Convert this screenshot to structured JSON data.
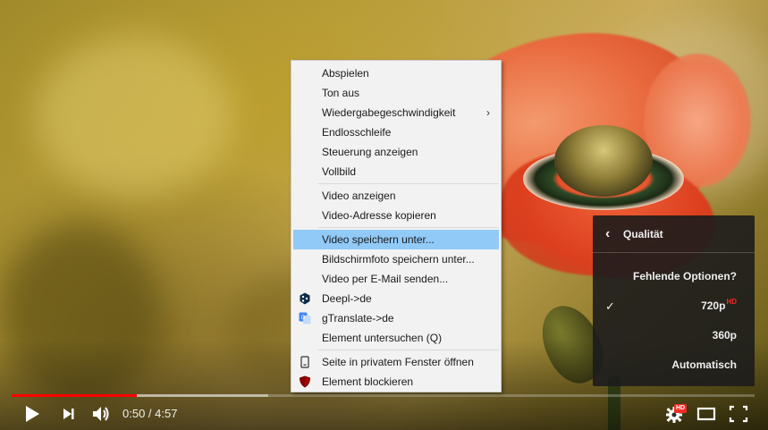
{
  "menu": {
    "items": [
      {
        "label": "Abspielen"
      },
      {
        "label": "Ton aus"
      },
      {
        "label": "Wiedergabegeschwindigkeit",
        "submenu_arrow": "›"
      },
      {
        "label": "Endlosschleife"
      },
      {
        "label": "Steuerung anzeigen"
      },
      {
        "label": "Vollbild"
      },
      {
        "label": "Video anzeigen"
      },
      {
        "label": "Video-Adresse kopieren"
      },
      {
        "label": "Video speichern unter..."
      },
      {
        "label": "Bildschirmfoto speichern unter..."
      },
      {
        "label": "Video per E-Mail senden..."
      },
      {
        "label": "Deepl->de",
        "icon": "deepl-icon"
      },
      {
        "label": "gTranslate->de",
        "icon": "gtranslate-icon"
      },
      {
        "label": "Element untersuchen (Q)"
      },
      {
        "label": "Seite in privatem Fenster öffnen",
        "icon": "private-window-icon"
      },
      {
        "label": "Element blockieren",
        "icon": "ublock-icon"
      }
    ],
    "highlighted_index": 8,
    "highlight_color": "#91c9f7"
  },
  "quality": {
    "title": "Qualität",
    "back_icon": "chevron-left-icon",
    "options": [
      {
        "label": "Fehlende Optionen?"
      },
      {
        "label": "720p",
        "badge": "HD",
        "selected": true,
        "check": "✓"
      },
      {
        "label": "360p"
      },
      {
        "label": "Automatisch"
      }
    ]
  },
  "player": {
    "current_time": "0:50",
    "separator": " / ",
    "duration": "4:57",
    "played_fraction": 0.168,
    "buffered_fraction": 0.345,
    "progress_color": "#ff0000",
    "hd_badge": "HD",
    "icons": [
      "play-icon",
      "next-icon",
      "volume-icon",
      "settings-gear-icon",
      "theater-mode-icon",
      "fullscreen-icon"
    ]
  }
}
